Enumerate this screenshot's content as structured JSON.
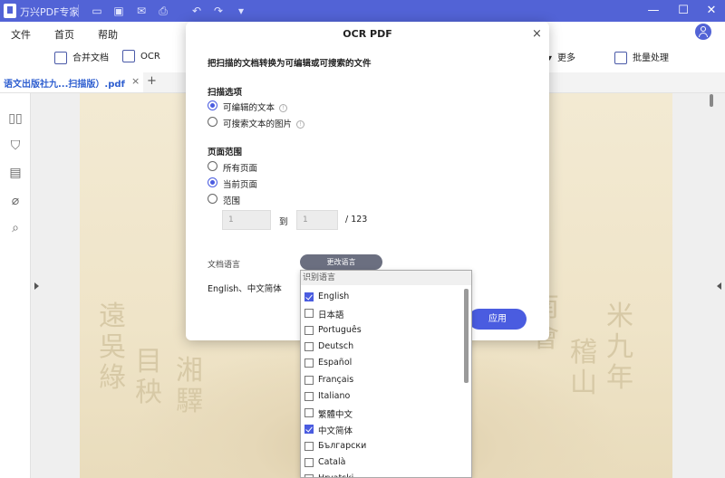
{
  "app": {
    "title": "万兴PDF专家"
  },
  "menu": {
    "file": "文件",
    "home": "首页",
    "help": "帮助"
  },
  "toolbar": {
    "combine": "合并文档",
    "ocr": "OCR",
    "more": "更多",
    "batch": "批量处理"
  },
  "tab": {
    "label": "语文出版社九...扫描版）.pdf",
    "close": "×",
    "add": "+"
  },
  "dialog": {
    "title": "OCR PDF",
    "close": "×",
    "description": "把扫描的文档转换为可编辑或可搜索的文件",
    "scan_options_title": "扫描选项",
    "scan_options": [
      {
        "label": "可编辑的文本",
        "selected": true
      },
      {
        "label": "可搜索文本的图片",
        "selected": false
      }
    ],
    "page_range_title": "页面范围",
    "page_range": [
      {
        "label": "所有页面",
        "selected": false
      },
      {
        "label": "当前页面",
        "selected": true
      },
      {
        "label": "范围",
        "selected": false
      }
    ],
    "range_from_placeholder": "1",
    "range_to_label": "到",
    "range_to_placeholder": "1",
    "range_total": "/ 123",
    "doc_language_label": "文档语言",
    "change_language_button": "更改语言",
    "current_languages": "English、中文简体",
    "apply_button": "应用"
  },
  "language_dropdown": {
    "header": "识别语言",
    "items": [
      {
        "label": "English",
        "checked": true
      },
      {
        "label": "日本語",
        "checked": false
      },
      {
        "label": "Português",
        "checked": false
      },
      {
        "label": "Deutsch",
        "checked": false
      },
      {
        "label": "Español",
        "checked": false
      },
      {
        "label": "Français",
        "checked": false
      },
      {
        "label": "Italiano",
        "checked": false
      },
      {
        "label": "繁體中文",
        "checked": false
      },
      {
        "label": "中文简体",
        "checked": true
      },
      {
        "label": "Български",
        "checked": false
      },
      {
        "label": "Català",
        "checked": false
      },
      {
        "label": "Hrvatski",
        "checked": false
      }
    ]
  },
  "colors": {
    "accent": "#4a5ce0",
    "titlebar": "#5263d6"
  }
}
